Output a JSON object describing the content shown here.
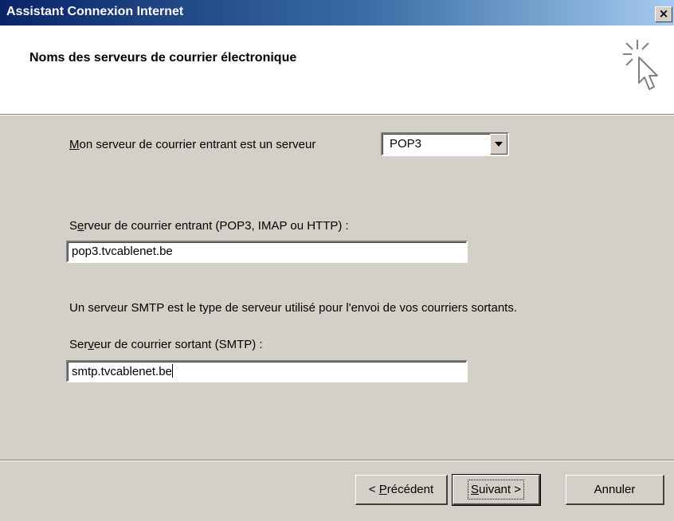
{
  "window": {
    "title": "Assistant Connexion Internet",
    "close_label": "×"
  },
  "header": {
    "title": "Noms des serveurs de courrier électronique",
    "icon": "wizard-cursor-sparkle-icon"
  },
  "incoming_type": {
    "label_mnemonic": "M",
    "label_rest": "on serveur de courrier entrant est un serveur",
    "selected": "POP3"
  },
  "incoming_server": {
    "label_pre": "S",
    "label_mnemonic": "e",
    "label_rest": "rveur de courrier entrant (POP3, IMAP ou HTTP) :",
    "value": "pop3.tvcablenet.be"
  },
  "smtp_info": "Un serveur SMTP est le type de serveur utilisé pour l'envoi de vos courriers sortants.",
  "outgoing_server": {
    "label_pre": "Ser",
    "label_mnemonic": "v",
    "label_rest": "eur de courrier sortant (SMTP) :",
    "value": "smtp.tvcablenet.be"
  },
  "buttons": {
    "back_prefix": "< ",
    "back_mnemonic": "P",
    "back_rest": "récédent",
    "next_mnemonic": "S",
    "next_rest": "uivant >",
    "cancel": "Annuler"
  }
}
